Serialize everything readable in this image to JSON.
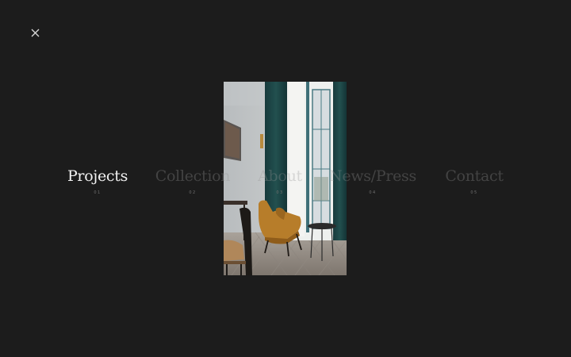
{
  "menu": {
    "items": [
      {
        "label": "Projects",
        "number": "01",
        "active": true
      },
      {
        "label": "Collection",
        "number": "02",
        "active": false
      },
      {
        "label": "About",
        "number": "03",
        "active": false
      },
      {
        "label": "News/Press",
        "number": "04",
        "active": false
      },
      {
        "label": "Contact",
        "number": "05",
        "active": false
      }
    ]
  },
  "close_icon": "close-icon",
  "colors": {
    "background": "#1c1c1c",
    "active_text": "#f2f2f2",
    "inactive_text": "#4a4a4a"
  }
}
